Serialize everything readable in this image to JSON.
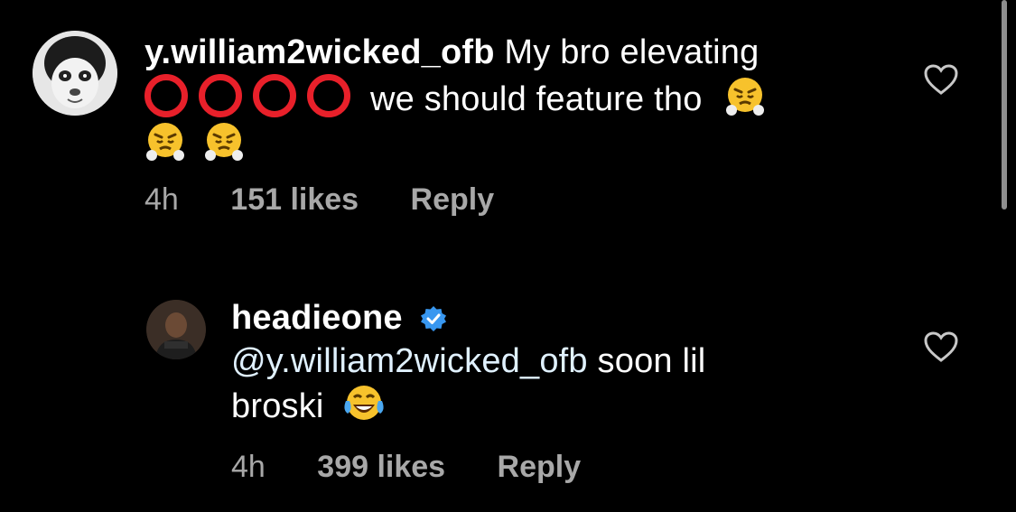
{
  "comments": [
    {
      "username": "y.william2wicked_ofb",
      "text_before_rings": "My bro elevating",
      "text_after_rings": "we should feature tho",
      "ring_count": 4,
      "ring_color": "#e8202a",
      "emoji_face": "face-with-steam-icon",
      "time": "4h",
      "likes": "151 likes",
      "reply_label": "Reply"
    },
    {
      "username": "headieone",
      "verified": true,
      "mention": "@y.william2wicked_ofb",
      "text_line1": "soon lil",
      "text_line2": "broski",
      "emoji_face": "tears-of-joy-icon",
      "time": "4h",
      "likes": "399 likes",
      "reply_label": "Reply"
    }
  ],
  "colors": {
    "background": "#000000",
    "text": "#ffffff",
    "meta": "#a8a8a8",
    "verified_badge": "#3897f0"
  }
}
